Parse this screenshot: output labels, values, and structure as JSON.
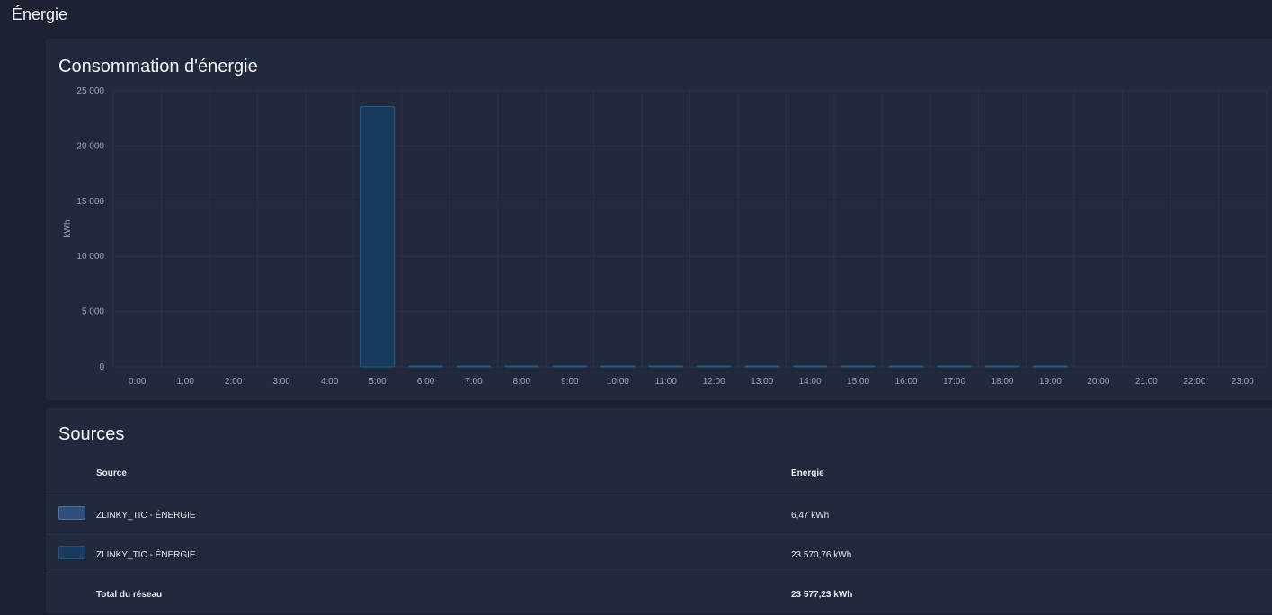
{
  "page": {
    "title": "Énergie"
  },
  "chart_card": {
    "title": "Consommation d'énergie"
  },
  "chart_data": {
    "type": "bar",
    "ylabel": "kWh",
    "xlabel": "",
    "ylim": [
      0,
      25000
    ],
    "yticks": [
      "0",
      "5 000",
      "10 000",
      "15 000",
      "20 000",
      "25 000"
    ],
    "ytick_values": [
      0,
      5000,
      10000,
      15000,
      20000,
      25000
    ],
    "categories": [
      "0:00",
      "1:00",
      "2:00",
      "3:00",
      "4:00",
      "5:00",
      "6:00",
      "7:00",
      "8:00",
      "9:00",
      "10:00",
      "11:00",
      "12:00",
      "13:00",
      "14:00",
      "15:00",
      "16:00",
      "17:00",
      "18:00",
      "19:00",
      "20:00",
      "21:00",
      "22:00",
      "23:00"
    ],
    "values": [
      0,
      0,
      0,
      0,
      0,
      23570.76,
      0.35,
      0.35,
      0.35,
      0.35,
      0.35,
      0.35,
      0.35,
      0.35,
      0.35,
      0.35,
      0.35,
      0.35,
      0.35,
      0.35,
      0,
      0,
      0,
      0
    ],
    "bar_color": "#173b5f",
    "bar_border": "#245b8a",
    "grid": true
  },
  "sources_card": {
    "title": "Sources",
    "headers": {
      "source": "Source",
      "energy": "Énergie"
    },
    "rows": [
      {
        "source": "ZLINKY_TIC - ÉNERGIE",
        "energy": "6,47 kWh",
        "color": "#2f4f7a"
      },
      {
        "source": "ZLINKY_TIC - ÉNERGIE",
        "energy": "23 570,76 kWh",
        "color": "#173b5f"
      }
    ],
    "total": {
      "label": "Total du réseau",
      "energy": "23 577,23 kWh"
    }
  }
}
